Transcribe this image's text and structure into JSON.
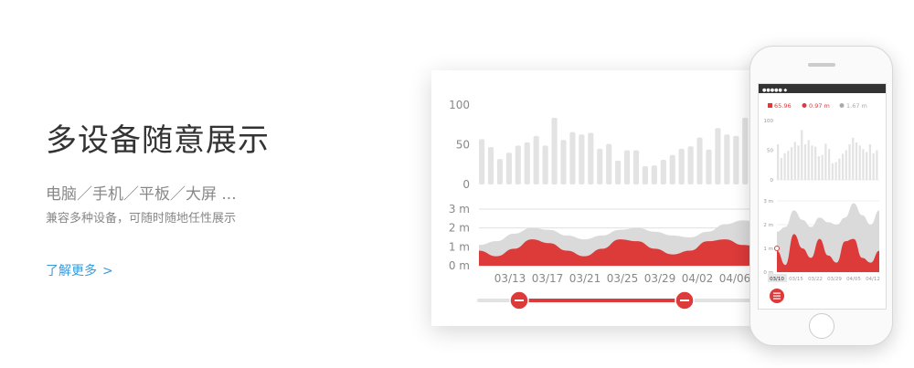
{
  "left": {
    "headline": "多设备随意展示",
    "devices": "电脑／手机／平板／大屏 ...",
    "description": "兼容多种设备，可随时随地任性展示",
    "more_link": "了解更多",
    "more_chevron": ">"
  },
  "colors": {
    "accent": "#dd3a3a",
    "bar": "#e3e3e3",
    "grid": "#e0e0e0",
    "wave_gray": "#dadada",
    "link": "#3a9bdc"
  },
  "phone_status": {
    "carrier": "●●●●● ◆"
  },
  "chart_data": [
    {
      "type": "bar",
      "yticks": [
        "100",
        "50",
        "0"
      ],
      "ylim": [
        0,
        100
      ],
      "values": [
        57,
        47,
        32,
        40,
        49,
        53,
        61,
        49,
        84,
        56,
        66,
        63,
        65,
        45,
        51,
        30,
        43,
        43,
        23,
        24,
        31,
        37,
        45,
        48,
        59,
        44,
        71,
        63,
        61,
        84,
        53
      ]
    },
    {
      "type": "area",
      "yticks": [
        "3 m",
        "2 m",
        "1 m",
        "0 m"
      ],
      "ylim": [
        0,
        3
      ],
      "xticks": [
        "03/13",
        "03/17",
        "03/21",
        "03/25",
        "03/29",
        "04/02",
        "04/06"
      ],
      "series": [
        {
          "values": [
            1.1,
            1.3,
            1.7,
            2.0,
            1.9,
            1.6,
            1.4,
            1.6,
            1.9,
            2.0,
            1.8,
            1.6,
            1.5,
            1.8,
            2.2,
            2.4,
            2.3
          ]
        },
        {
          "values": [
            0.8,
            0.5,
            0.9,
            1.4,
            1.2,
            0.8,
            0.5,
            0.9,
            1.4,
            1.3,
            0.9,
            0.6,
            0.8,
            1.3,
            1.4,
            1.1,
            1.0
          ]
        }
      ]
    },
    {
      "type": "bar",
      "legend": [
        "65.96",
        "0.97 m",
        "1.67 m"
      ],
      "yticks": [
        "100",
        "50",
        "0"
      ],
      "ylim": [
        0,
        100
      ],
      "values": [
        60,
        37,
        45,
        49,
        55,
        64,
        58,
        84,
        60,
        67,
        58,
        56,
        40,
        42,
        61,
        52,
        28,
        30,
        36,
        44,
        50,
        60,
        71,
        63,
        58,
        52,
        47,
        60,
        45,
        50
      ]
    },
    {
      "type": "area",
      "yticks": [
        "3 m",
        "2 m",
        "1 m",
        "0 m"
      ],
      "ylim": [
        0,
        3
      ],
      "xticks": [
        "03/10",
        "03/15",
        "03/22",
        "03/29",
        "04/05",
        "04/12"
      ],
      "series": [
        {
          "values": [
            1.7,
            1.9,
            2.6,
            2.2,
            1.9,
            2.3,
            2.1,
            2.0,
            2.3,
            2.9,
            2.4,
            2.0,
            2.6
          ]
        },
        {
          "values": [
            0.9,
            0.3,
            1.6,
            1.0,
            0.6,
            1.4,
            0.7,
            0.4,
            1.3,
            1.4,
            0.6,
            0.4,
            0.9
          ]
        }
      ]
    }
  ]
}
